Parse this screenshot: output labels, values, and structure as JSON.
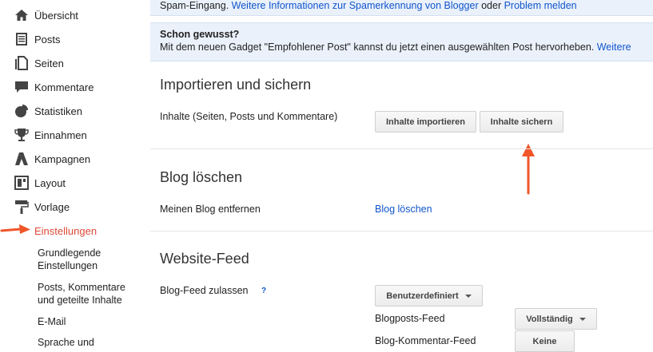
{
  "sidebar": {
    "items": [
      {
        "label": "Übersicht",
        "icon": "home-icon"
      },
      {
        "label": "Posts",
        "icon": "posts-icon"
      },
      {
        "label": "Seiten",
        "icon": "pages-icon"
      },
      {
        "label": "Kommentare",
        "icon": "comment-icon"
      },
      {
        "label": "Statistiken",
        "icon": "pie-chart-icon"
      },
      {
        "label": "Einnahmen",
        "icon": "trophy-icon"
      },
      {
        "label": "Kampagnen",
        "icon": "adwords-icon"
      },
      {
        "label": "Layout",
        "icon": "layout-icon"
      },
      {
        "label": "Vorlage",
        "icon": "paint-roller-icon"
      },
      {
        "label": "Einstellungen",
        "icon": "red-arrow-icon"
      }
    ],
    "active": "Einstellungen",
    "active_color": "#dd4b39",
    "subitems": [
      "Grundlegende Einstellungen",
      "Posts, Kommentare und geteilte Inhalte",
      "E-Mail",
      "Sprache und"
    ]
  },
  "banner1": {
    "text": "Spam-Eingang. ",
    "link1": "Weitere Informationen zur Spamerkennung von Blogger",
    "middle": " oder ",
    "link2": "Problem melden"
  },
  "banner2": {
    "title": "Schon gewusst?",
    "text": "Mit dem neuen Gadget \"Empfohlener Post\" kannst du jetzt einen ausgewählten Post hervorheben. ",
    "link": "Weitere"
  },
  "import": {
    "title": "Importieren und sichern",
    "label": "Inhalte (Seiten, Posts und Kommentare)",
    "import_button": "Inhalte importieren",
    "backup_button": "Inhalte sichern"
  },
  "delete": {
    "title": "Blog löschen",
    "label": "Meinen Blog entfernen",
    "link": "Blog löschen"
  },
  "feed": {
    "title": "Website-Feed",
    "allow_label": "Blog-Feed zulassen",
    "help": "?",
    "allow_value": "Benutzerdefiniert",
    "posts_label": "Blogposts-Feed",
    "posts_value": "Vollständig",
    "comments_label": "Blog-Kommentar-Feed",
    "comments_value": "Keine"
  },
  "colors": {
    "link": "#1155cc",
    "annotation_arrow": "#f0562a",
    "banner_bg": "#eaf1fb"
  }
}
